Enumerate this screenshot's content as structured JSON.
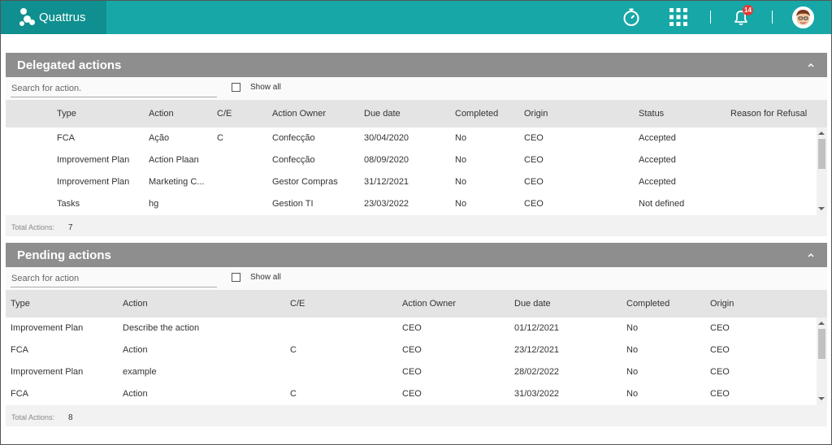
{
  "app": {
    "title": "Quattrus",
    "notifications_count": "14"
  },
  "icons": {
    "timer": "stopwatch-icon",
    "apps": "grid-icon",
    "notifications": "bell-icon",
    "profile": "avatar-icon",
    "collapse": "chevron-up-icon"
  },
  "colors": {
    "brand": "#17a7a7",
    "brand_dark": "#0f8f8f",
    "panel_header": "#8e8e8e",
    "badge": "#e53935"
  },
  "delegated": {
    "title": "Delegated actions",
    "search_placeholder": "Search for action.",
    "show_all_label": "Show all",
    "columns": [
      "Type",
      "Action",
      "C/E",
      "Action Owner",
      "Due date",
      "Completed",
      "Origin",
      "Status",
      "Reason for Refusal"
    ],
    "rows": [
      [
        "FCA",
        "Ação",
        "C",
        "Confecção",
        "30/04/2020",
        "No",
        "CEO",
        "Accepted",
        ""
      ],
      [
        "Improvement Plan",
        "Action Plaan",
        "",
        "Confecção",
        "08/09/2020",
        "No",
        "CEO",
        "Accepted",
        ""
      ],
      [
        "Improvement Plan",
        "Marketing C...",
        "",
        "Gestor Compras",
        "31/12/2021",
        "No",
        "CEO",
        "Accepted",
        ""
      ],
      [
        "Tasks",
        "hg",
        "",
        "Gestion TI",
        "23/03/2022",
        "No",
        "CEO",
        "Not defined",
        ""
      ]
    ],
    "total_label": "Total Actions:",
    "total_value": "7"
  },
  "pending": {
    "title": "Pending actions",
    "search_placeholder": "Search for action",
    "show_all_label": "Show all",
    "columns": [
      "Type",
      "Action",
      "C/E",
      "Action Owner",
      "Due date",
      "Completed",
      "Origin"
    ],
    "rows": [
      [
        "Improvement Plan",
        "Describe the action",
        "",
        "CEO",
        "01/12/2021",
        "No",
        "CEO"
      ],
      [
        "FCA",
        "Action",
        "C",
        "CEO",
        "23/12/2021",
        "No",
        "CEO"
      ],
      [
        "Improvement Plan",
        "example",
        "",
        "CEO",
        "28/02/2022",
        "No",
        "CEO"
      ],
      [
        "FCA",
        "Action",
        "C",
        "CEO",
        "31/03/2022",
        "No",
        "CEO"
      ]
    ],
    "total_label": "Total Actions:",
    "total_value": "8"
  }
}
